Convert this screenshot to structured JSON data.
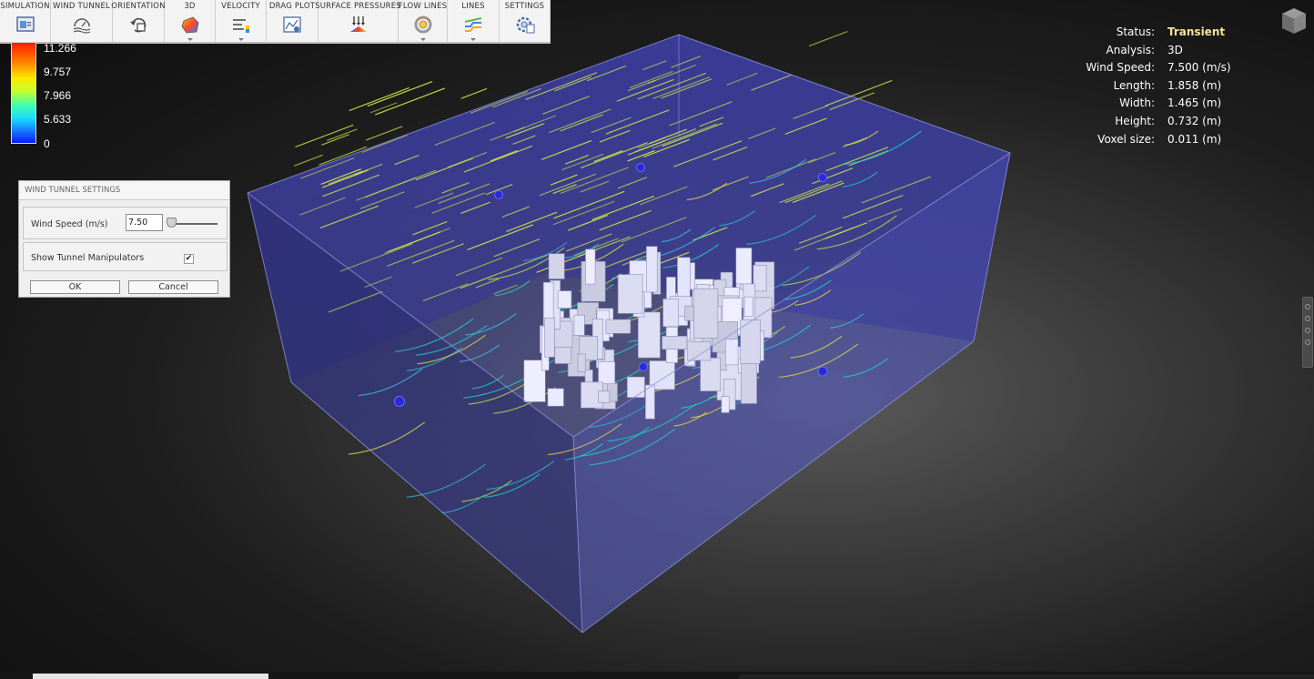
{
  "toolbar": {
    "items": [
      {
        "label": "SIMULATION",
        "icon": "simulation-icon",
        "dropdown": false
      },
      {
        "label": "WIND TUNNEL",
        "icon": "wind-tunnel-icon",
        "dropdown": false
      },
      {
        "label": "ORIENTATION",
        "icon": "orientation-icon",
        "dropdown": false
      },
      {
        "label": "3D",
        "icon": "3d-icon",
        "dropdown": true
      },
      {
        "label": "VELOCITY",
        "icon": "velocity-icon",
        "dropdown": true
      },
      {
        "label": "DRAG PLOT",
        "icon": "drag-plot-icon",
        "dropdown": false
      },
      {
        "label": "SURFACE PRESSURES",
        "icon": "surface-pressures-icon",
        "dropdown": false
      },
      {
        "label": "FLOW LINES",
        "icon": "flow-lines-icon",
        "dropdown": true
      },
      {
        "label": "LINES",
        "icon": "lines-icon",
        "dropdown": true
      },
      {
        "label": "SETTINGS",
        "icon": "settings-icon",
        "dropdown": false
      }
    ]
  },
  "legend": {
    "ticks": [
      "11.266",
      "9.757",
      "7.966",
      "5.633",
      "0"
    ],
    "colors": [
      "#ff1b00",
      "#ffe600",
      "#3dffb5",
      "#19d8ff",
      "#0a1cff"
    ]
  },
  "status": {
    "rows": [
      {
        "key": "Status:",
        "value": "Transient",
        "highlight": true
      },
      {
        "key": "Analysis:",
        "value": "3D"
      },
      {
        "key": "Wind Speed:",
        "value": "7.500 (m/s)"
      },
      {
        "key": "Length:",
        "value": "1.858 (m)"
      },
      {
        "key": "Width:",
        "value": "1.465 (m)"
      },
      {
        "key": "Height:",
        "value": "0.732 (m)"
      },
      {
        "key": "Voxel size:",
        "value": "0.011 (m)"
      }
    ],
    "highlight_color": "#f6e29a"
  },
  "dialog": {
    "title": "WIND TUNNEL SETTINGS",
    "wind_speed_label": "Wind Speed (m/s)",
    "wind_speed_value": "7.50",
    "manipulators_label": "Show Tunnel Manipulators",
    "manipulators_checked": true,
    "check_glyph": "✔",
    "ok_label": "OK",
    "cancel_label": "Cancel"
  },
  "scene": {
    "tunnel_color": "#3a3ab0",
    "streamline_color": "#cfe24a",
    "building_color": "#d9d6f0",
    "manipulator_color": "#2a2ad8"
  }
}
